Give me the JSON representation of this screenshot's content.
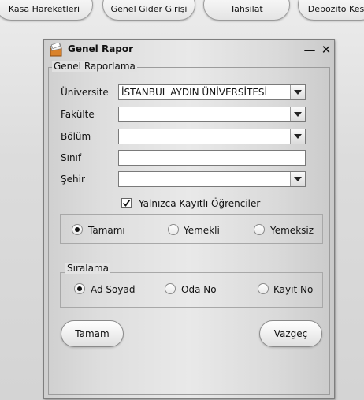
{
  "tabs": [
    "Kasa Hareketleri",
    "Genel Gider Girişi",
    "Tahsilat",
    "Depozito Kesi"
  ],
  "dialog": {
    "title": "Genel Rapor",
    "group_title": "Genel Raporlama",
    "fields": {
      "universite": {
        "label": "Üniversite",
        "value": "İSTANBUL AYDIN ÜNİVERSİTESİ"
      },
      "fakulte": {
        "label": "Fakülte",
        "value": ""
      },
      "bolum": {
        "label": "Bölüm",
        "value": ""
      },
      "sinif": {
        "label": "Sınıf",
        "value": ""
      },
      "sehir": {
        "label": "Şehir",
        "value": ""
      }
    },
    "checkbox": {
      "label": "Yalnızca Kayıtlı Öğrenciler",
      "checked": true
    },
    "meal_options": [
      {
        "label": "Tamamı",
        "selected": true
      },
      {
        "label": "Yemekli",
        "selected": false
      },
      {
        "label": "Yemeksiz",
        "selected": false
      }
    ],
    "sort_group_title": "Sıralama",
    "sort_options": [
      {
        "label": "Ad Soyad",
        "selected": true
      },
      {
        "label": "Oda No",
        "selected": false
      },
      {
        "label": "Kayıt No",
        "selected": false
      }
    ],
    "ok_label": "Tamam",
    "cancel_label": "Vazgeç",
    "minimize_glyph": "—",
    "close_glyph": "✕"
  }
}
